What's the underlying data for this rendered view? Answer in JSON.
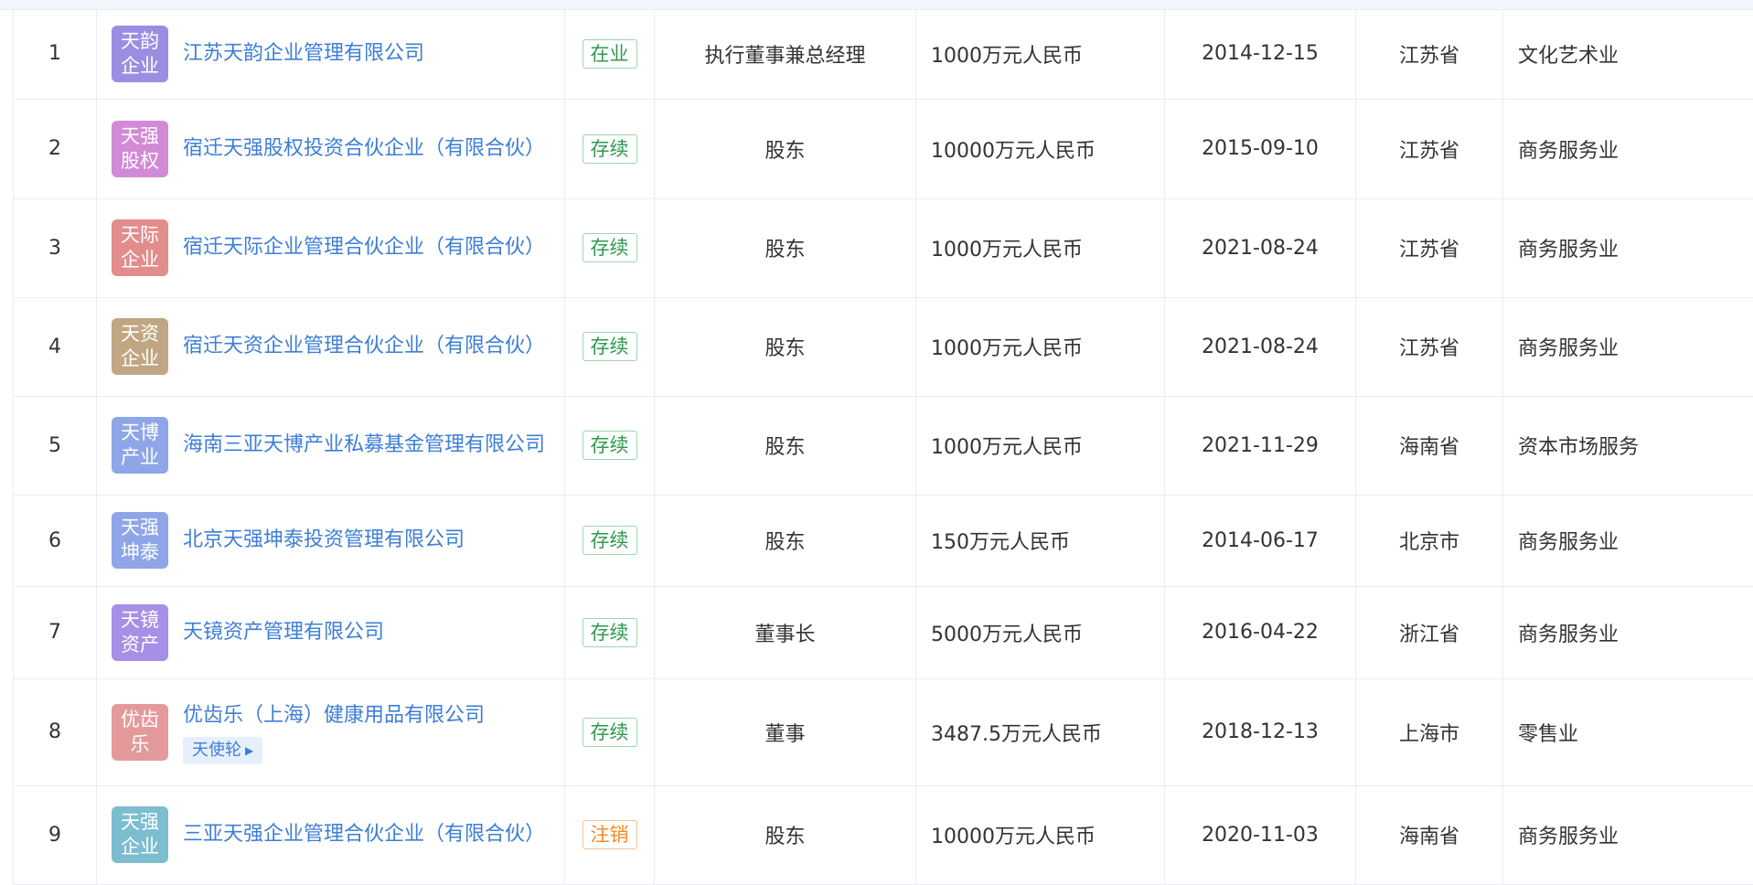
{
  "colors": {
    "link": "#3d7ed6",
    "status_active": "#2e9a4f",
    "status_cancelled": "#f08c2b"
  },
  "rows": [
    {
      "index": "1",
      "logo": "天韵企业",
      "logo_color": "#9b8ee2",
      "name": "江苏天韵企业管理有限公司",
      "tag": "",
      "status": "在业",
      "status_color": "#2e9a4f",
      "role": "执行董事兼总经理",
      "capital": "1000万元人民币",
      "date": "2014-12-15",
      "province": "江苏省",
      "industry": "文化艺术业"
    },
    {
      "index": "2",
      "logo": "天强股权",
      "logo_color": "#d18ad6",
      "name": "宿迁天强股权投资合伙企业（有限合伙）",
      "tag": "",
      "status": "存续",
      "status_color": "#2e9a4f",
      "role": "股东",
      "capital": "10000万元人民币",
      "date": "2015-09-10",
      "province": "江苏省",
      "industry": "商务服务业"
    },
    {
      "index": "3",
      "logo": "天际企业",
      "logo_color": "#e38c8c",
      "name": "宿迁天际企业管理合伙企业（有限合伙）",
      "tag": "",
      "status": "存续",
      "status_color": "#2e9a4f",
      "role": "股东",
      "capital": "1000万元人民币",
      "date": "2021-08-24",
      "province": "江苏省",
      "industry": "商务服务业"
    },
    {
      "index": "4",
      "logo": "天资企业",
      "logo_color": "#c0a682",
      "name": "宿迁天资企业管理合伙企业（有限合伙）",
      "tag": "",
      "status": "存续",
      "status_color": "#2e9a4f",
      "role": "股东",
      "capital": "1000万元人民币",
      "date": "2021-08-24",
      "province": "江苏省",
      "industry": "商务服务业"
    },
    {
      "index": "5",
      "logo": "天博产业",
      "logo_color": "#8ea6e8",
      "name": "海南三亚天博产业私募基金管理有限公司",
      "tag": "",
      "status": "存续",
      "status_color": "#2e9a4f",
      "role": "股东",
      "capital": "1000万元人民币",
      "date": "2021-11-29",
      "province": "海南省",
      "industry": "资本市场服务"
    },
    {
      "index": "6",
      "logo": "天强坤泰",
      "logo_color": "#8ea6e8",
      "name": "北京天强坤泰投资管理有限公司",
      "tag": "",
      "status": "存续",
      "status_color": "#2e9a4f",
      "role": "股东",
      "capital": "150万元人民币",
      "date": "2014-06-17",
      "province": "北京市",
      "industry": "商务服务业"
    },
    {
      "index": "7",
      "logo": "天镜资产",
      "logo_color": "#a68fe6",
      "name": "天镜资产管理有限公司",
      "tag": "",
      "status": "存续",
      "status_color": "#2e9a4f",
      "role": "董事长",
      "capital": "5000万元人民币",
      "date": "2016-04-22",
      "province": "浙江省",
      "industry": "商务服务业"
    },
    {
      "index": "8",
      "logo": "优齿乐",
      "logo_color": "#e49a9a",
      "name": "优齿乐（上海）健康用品有限公司",
      "tag": "天使轮",
      "status": "存续",
      "status_color": "#2e9a4f",
      "role": "董事",
      "capital": "3487.5万元人民币",
      "date": "2018-12-13",
      "province": "上海市",
      "industry": "零售业"
    },
    {
      "index": "9",
      "logo": "天强企业",
      "logo_color": "#7cbdd0",
      "name": "三亚天强企业管理合伙企业（有限合伙）",
      "tag": "",
      "status": "注销",
      "status_color": "#f08c2b",
      "role": "股东",
      "capital": "10000万元人民币",
      "date": "2020-11-03",
      "province": "海南省",
      "industry": "商务服务业"
    }
  ]
}
